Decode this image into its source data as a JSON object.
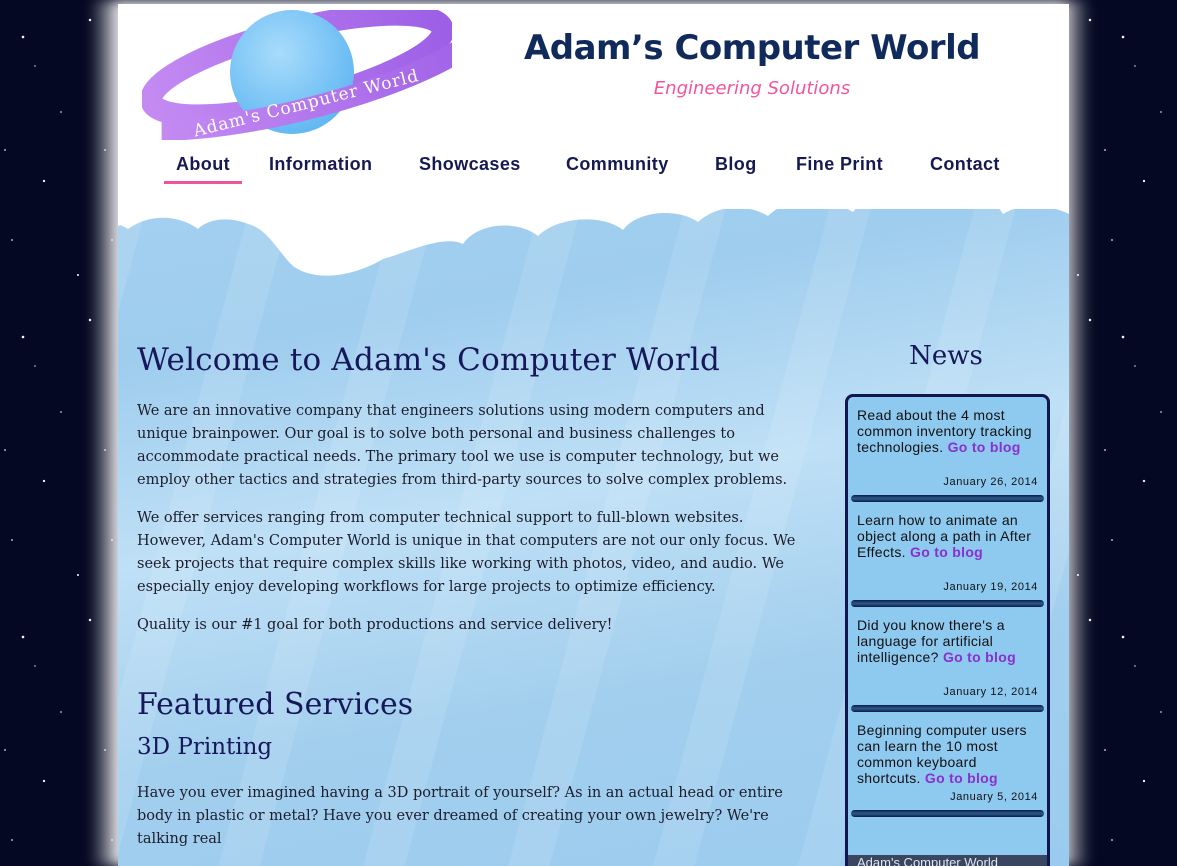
{
  "site": {
    "logo_text": "Adam's Computer World",
    "title": "Adam’s Computer World",
    "tagline": "Engineering Solutions"
  },
  "nav": {
    "items": [
      {
        "label": "About",
        "active": true
      },
      {
        "label": "Information",
        "active": false
      },
      {
        "label": "Showcases",
        "active": false
      },
      {
        "label": "Community",
        "active": false
      },
      {
        "label": "Blog",
        "active": false
      },
      {
        "label": "Fine Print",
        "active": false
      },
      {
        "label": "Contact",
        "active": false
      }
    ]
  },
  "main": {
    "heading": "Welcome to Adam's Computer World",
    "paragraphs": [
      "We are an innovative company that engineers solutions using modern computers and unique brainpower. Our goal is to solve both personal and business challenges to accommodate practical needs. The primary tool we use is computer technology, but we employ other tactics and strategies from third-party sources to solve complex problems.",
      "We offer services ranging from computer technical support to full-blown websites. However, Adam's Computer World is unique in that computers are not our only focus. We seek projects that require complex skills like working with photos, video, and audio. We especially enjoy developing workflows for large projects to optimize efficiency.",
      "Quality is our #1 goal for both productions and service delivery!"
    ],
    "featured_heading": "Featured Services",
    "service_heading": "3D Printing",
    "service_text": "Have you ever imagined having a 3D portrait of yourself? As in an actual head or entire body in plastic or metal? Have you ever dreamed of creating your own jewelry? We're talking real"
  },
  "news": {
    "title": "News",
    "items": [
      {
        "text": "Read about the 4 most common inventory tracking technologies.",
        "link": "Go to blog",
        "date": "January 26, 2014"
      },
      {
        "text": "Learn how to animate an object along a path in After Effects.",
        "link": "Go to blog",
        "date": "January 19, 2014"
      },
      {
        "text": "Did you know there's a language for artificial intelligence?",
        "link": "Go to blog",
        "date": "January 12, 2014"
      },
      {
        "text": "Beginning computer users can learn the 10 most common keyboard shortcuts.",
        "link": "Go to blog",
        "date": "January 5, 2014"
      }
    ],
    "footer_text": "Adam's Computer World"
  },
  "colors": {
    "title": "#102a5c",
    "tagline": "#f2559e",
    "nav_text": "#161a52",
    "nav_active_underline": "#f0559b",
    "heading": "#16185a",
    "news_link": "#8a2fd0",
    "news_box": "#8ec9f0",
    "planet": "#7ec8f6",
    "ring": "#b97ef0"
  }
}
